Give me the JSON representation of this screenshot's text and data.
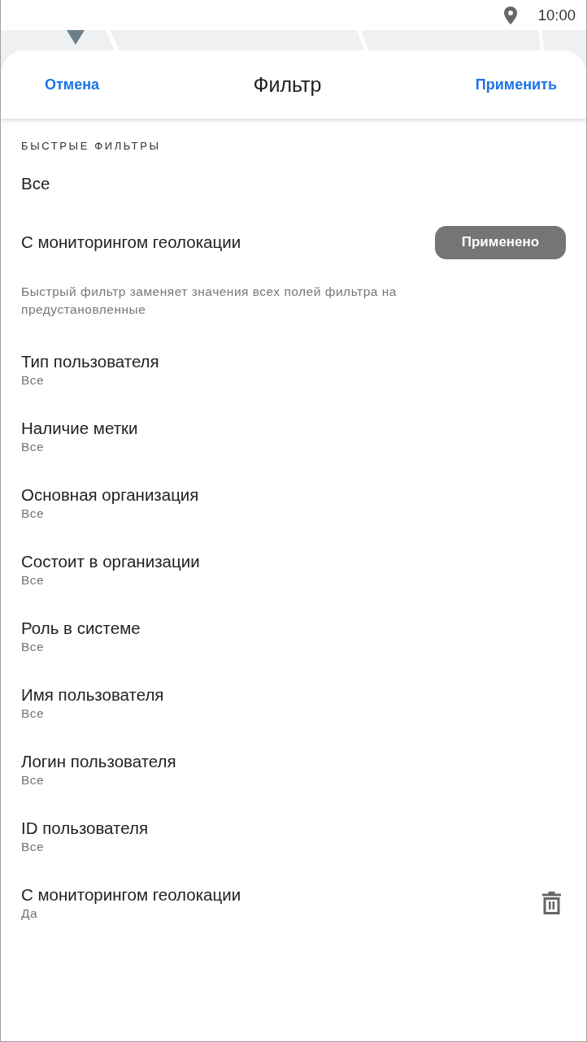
{
  "status_bar": {
    "time": "10:00"
  },
  "header": {
    "cancel": "Отмена",
    "title": "Фильтр",
    "apply": "Применить"
  },
  "quick_filters": {
    "heading": "БЫСТРЫЕ ФИЛЬТРЫ",
    "items": [
      {
        "label": "Все",
        "applied": false
      },
      {
        "label": "С мониторингом геолокации",
        "applied": true,
        "applied_label": "Применено"
      }
    ],
    "hint": "Быстрый фильтр заменяет значения всех полей фильтра на предустановленные"
  },
  "filters": [
    {
      "title": "Тип пользователя",
      "value": "Все",
      "removable": false
    },
    {
      "title": "Наличие метки",
      "value": "Все",
      "removable": false
    },
    {
      "title": "Основная организация",
      "value": "Все",
      "removable": false
    },
    {
      "title": "Состоит в организации",
      "value": "Все",
      "removable": false
    },
    {
      "title": "Роль в системе",
      "value": "Все",
      "removable": false
    },
    {
      "title": "Имя пользователя",
      "value": "Все",
      "removable": false
    },
    {
      "title": "Логин пользователя",
      "value": "Все",
      "removable": false
    },
    {
      "title": "ID пользователя",
      "value": "Все",
      "removable": false
    },
    {
      "title": "С мониторингом геолокации",
      "value": "Да",
      "removable": true
    }
  ]
}
